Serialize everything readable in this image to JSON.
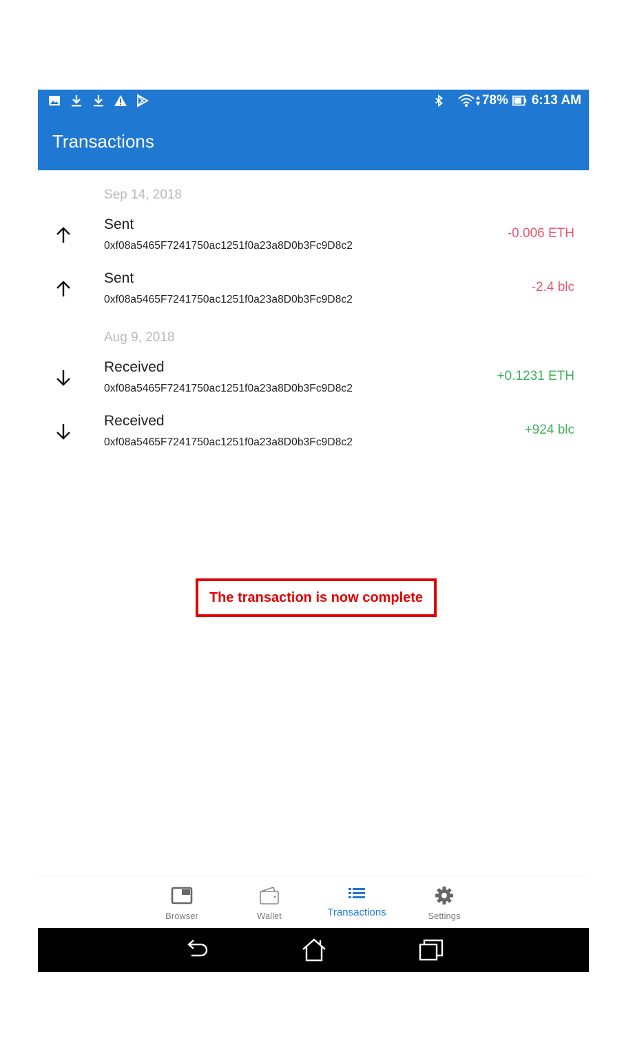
{
  "status_bar": {
    "battery": "78%",
    "time": "6:13 AM",
    "left_icons": [
      "image-icon",
      "download-icon",
      "download-icon",
      "warning-icon",
      "play-store-icon"
    ],
    "right_icons": [
      "bluetooth-icon",
      "wifi-icon",
      "battery-icon"
    ]
  },
  "app_bar": {
    "title": "Transactions"
  },
  "groups": [
    {
      "date": "Sep 14, 2018",
      "transactions": [
        {
          "type": "Sent",
          "address": "0xf08a5465F7241750ac1251f0a23a8D0b3Fc9D8c2",
          "amount": "-0.006 ETH",
          "direction": "up"
        },
        {
          "type": "Sent",
          "address": "0xf08a5465F7241750ac1251f0a23a8D0b3Fc9D8c2",
          "amount": "-2.4 blc",
          "direction": "up"
        }
      ]
    },
    {
      "date": "Aug 9, 2018",
      "transactions": [
        {
          "type": "Received",
          "address": "0xf08a5465F7241750ac1251f0a23a8D0b3Fc9D8c2",
          "amount": "+0.1231 ETH",
          "direction": "down"
        },
        {
          "type": "Received",
          "address": "0xf08a5465F7241750ac1251f0a23a8D0b3Fc9D8c2",
          "amount": "+924 blc",
          "direction": "down"
        }
      ]
    }
  ],
  "notice": {
    "text": "The transaction is now complete"
  },
  "bottom_nav": {
    "items": [
      {
        "label": "Browser",
        "icon": "browser-icon",
        "active": false
      },
      {
        "label": "Wallet",
        "icon": "wallet-icon",
        "active": false
      },
      {
        "label": "Transactions",
        "icon": "list-icon",
        "active": true
      },
      {
        "label": "Settings",
        "icon": "gear-icon",
        "active": false
      }
    ]
  },
  "colors": {
    "primary": "#1f78d1",
    "negative": "#e8566a",
    "positive": "#3cb05a",
    "date_header": "#b9b9b9",
    "notice": "#e00000"
  }
}
